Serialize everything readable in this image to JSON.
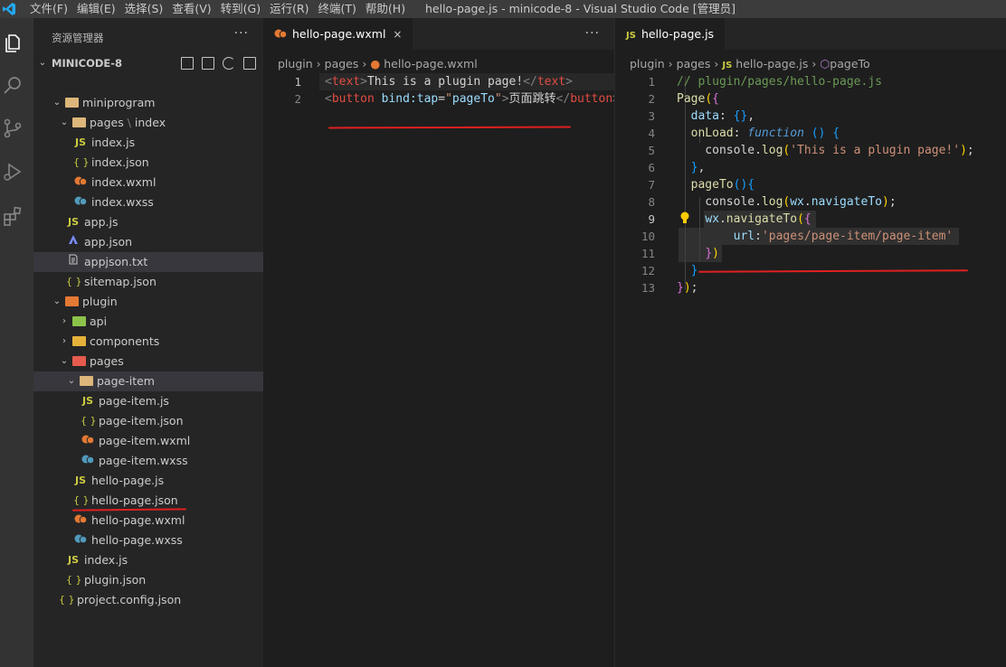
{
  "titlebar": {
    "menu": [
      "文件(F)",
      "编辑(E)",
      "选择(S)",
      "查看(V)",
      "转到(G)",
      "运行(R)",
      "终端(T)",
      "帮助(H)"
    ],
    "window_title": "hello-page.js - minicode-8 - Visual Studio Code [管理员]"
  },
  "sidebar": {
    "title": "资源管理器",
    "more": "···",
    "root": "MINICODE-8",
    "tree": [
      {
        "label": "miniprogram",
        "kind": "folder",
        "chev": "⌄"
      },
      {
        "label": "pages",
        "label2": "index",
        "kind": "folder",
        "chev": "⌄"
      },
      {
        "label": "index.js",
        "kind": "js"
      },
      {
        "label": "index.json",
        "kind": "json"
      },
      {
        "label": "index.wxml",
        "kind": "wxml"
      },
      {
        "label": "index.wxss",
        "kind": "wxss"
      },
      {
        "label": "app.js",
        "kind": "js"
      },
      {
        "label": "app.json",
        "kind": "appjson"
      },
      {
        "label": "appjson.txt",
        "kind": "txt"
      },
      {
        "label": "sitemap.json",
        "kind": "json"
      },
      {
        "label": "plugin",
        "kind": "folder",
        "chev": "⌄"
      },
      {
        "label": "api",
        "kind": "folder",
        "chev": "›"
      },
      {
        "label": "components",
        "kind": "folder",
        "chev": "›"
      },
      {
        "label": "pages",
        "kind": "folder",
        "chev": "⌄"
      },
      {
        "label": "page-item",
        "kind": "folder",
        "chev": "⌄"
      },
      {
        "label": "page-item.js",
        "kind": "js"
      },
      {
        "label": "page-item.json",
        "kind": "json"
      },
      {
        "label": "page-item.wxml",
        "kind": "wxml"
      },
      {
        "label": "page-item.wxss",
        "kind": "wxss"
      },
      {
        "label": "hello-page.js",
        "kind": "js"
      },
      {
        "label": "hello-page.json",
        "kind": "json"
      },
      {
        "label": "hello-page.wxml",
        "kind": "wxml"
      },
      {
        "label": "hello-page.wxss",
        "kind": "wxss"
      },
      {
        "label": "index.js",
        "kind": "js"
      },
      {
        "label": "plugin.json",
        "kind": "json"
      },
      {
        "label": "project.config.json",
        "kind": "json"
      }
    ]
  },
  "icons": {
    "js": "JS",
    "json": "{ }",
    "wxml": "wxml-icon",
    "wxss": "wxss-icon"
  },
  "editor_left": {
    "tab": "hello-page.wxml",
    "close": "×",
    "more": "···",
    "breadcrumb": [
      "plugin",
      "pages",
      "hello-page.wxml"
    ],
    "line_numbers": [
      "1",
      "2"
    ]
  },
  "editor_right": {
    "tab": "hello-page.js",
    "breadcrumb": [
      "plugin",
      "pages",
      "hello-page.js",
      "pageTo"
    ],
    "line_numbers": [
      "1",
      "2",
      "3",
      "4",
      "5",
      "6",
      "7",
      "8",
      "9",
      "10",
      "11",
      "12",
      "13"
    ]
  },
  "colors": {
    "annotation_red": "#e02020",
    "bulb": "#ffcc00"
  }
}
